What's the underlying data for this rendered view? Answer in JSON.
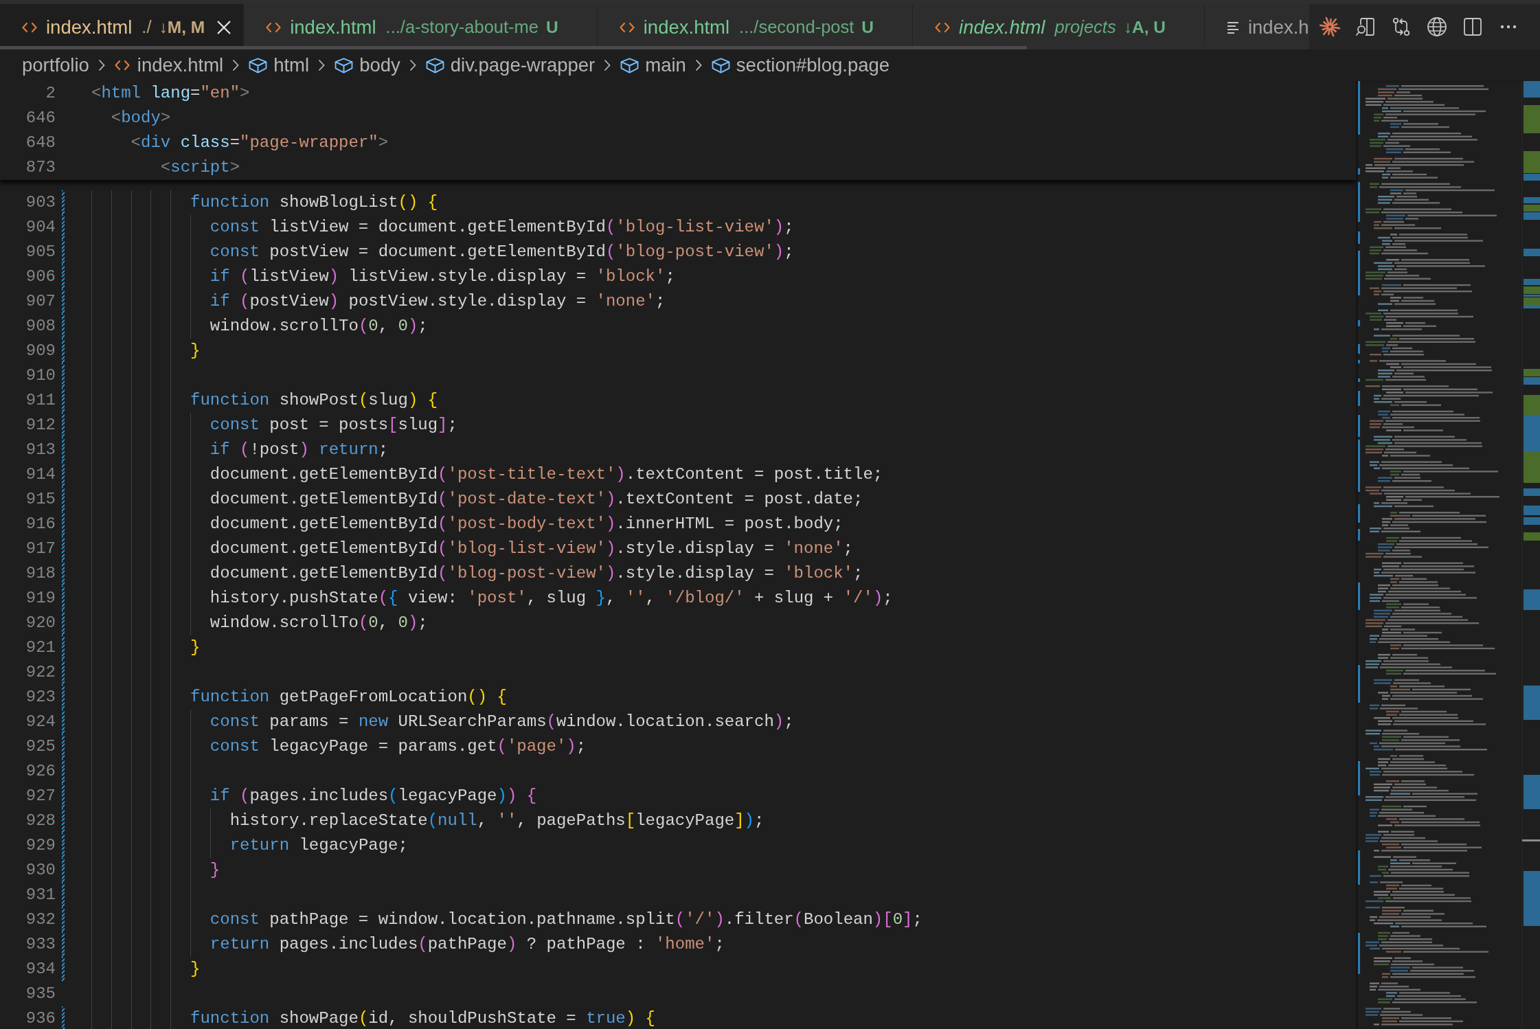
{
  "tabs": [
    {
      "kind": "html_file",
      "label": "index.html",
      "description": "./",
      "badge": "↓M, M",
      "color": "#e2c08d",
      "selected": true,
      "preview": false
    },
    {
      "kind": "html_file",
      "label": "index.html",
      "description": ".../a-story-about-me",
      "badge": "U",
      "color": "#73c991",
      "selected": false,
      "preview": false
    },
    {
      "kind": "html_file",
      "label": "index.html",
      "description": ".../second-post",
      "badge": "U",
      "color": "#73c991",
      "selected": false,
      "preview": false
    },
    {
      "kind": "html_file",
      "label": "index.html",
      "description": "projects",
      "badge": "↓A, U",
      "color": "#73c991",
      "selected": false,
      "preview": true
    },
    {
      "kind": "page_preview",
      "label": "index.h",
      "color": "#a0a0a0",
      "selected": false,
      "preview": false
    }
  ],
  "breadcrumbs": [
    {
      "kind": "folder",
      "label": "portfolio"
    },
    {
      "kind": "file",
      "label": "index.html"
    },
    {
      "kind": "element",
      "label": "html"
    },
    {
      "kind": "element",
      "label": "body"
    },
    {
      "kind": "element",
      "label": "div.page-wrapper"
    },
    {
      "kind": "element",
      "label": "main"
    },
    {
      "kind": "element",
      "label": "section#blog.page"
    }
  ],
  "sticky_scroll": [
    {
      "number": "2",
      "tokens": [
        {
          "text": "<",
          "kind": "tag_punct"
        },
        {
          "text": "html",
          "kind": "tag"
        },
        {
          "text": " lang",
          "kind": "attr"
        },
        {
          "text": "=",
          "kind": "plain"
        },
        {
          "text": "\"en\"",
          "kind": "string"
        },
        {
          "text": ">",
          "kind": "tag_punct"
        }
      ]
    },
    {
      "number": "646",
      "tokens": [
        {
          "text": "  <",
          "kind": "tag_punct"
        },
        {
          "text": "body",
          "kind": "tag"
        },
        {
          "text": ">",
          "kind": "tag_punct"
        }
      ]
    },
    {
      "number": "648",
      "tokens": [
        {
          "text": "    <",
          "kind": "tag_punct"
        },
        {
          "text": "div",
          "kind": "tag"
        },
        {
          "text": " class",
          "kind": "attr"
        },
        {
          "text": "=",
          "kind": "plain"
        },
        {
          "text": "\"page-wrapper\"",
          "kind": "string"
        },
        {
          "text": ">",
          "kind": "tag_punct"
        }
      ]
    },
    {
      "number": "873",
      "tokens": [
        {
          "text": "       <",
          "kind": "tag_punct"
        },
        {
          "text": "script",
          "kind": "tag"
        },
        {
          "text": ">",
          "kind": "tag_punct"
        }
      ]
    }
  ],
  "code_lines": [
    {
      "number": "903",
      "changed": true,
      "tokens": [
        {
          "text": "          function",
          "kind": "keyword"
        },
        {
          "text": " showBlogList",
          "kind": "plain"
        },
        {
          "text": "() {",
          "kind": "bracket1"
        }
      ]
    },
    {
      "number": "904",
      "changed": true,
      "tokens": [
        {
          "text": "            const",
          "kind": "keyword"
        },
        {
          "text": " listView = document.getElementById",
          "kind": "plain"
        },
        {
          "text": "(",
          "kind": "bracket2"
        },
        {
          "text": "'blog-list-view'",
          "kind": "string"
        },
        {
          "text": ")",
          "kind": "bracket2"
        },
        {
          "text": ";",
          "kind": "plain"
        }
      ]
    },
    {
      "number": "905",
      "changed": true,
      "tokens": [
        {
          "text": "            const",
          "kind": "keyword"
        },
        {
          "text": " postView = document.getElementById",
          "kind": "plain"
        },
        {
          "text": "(",
          "kind": "bracket2"
        },
        {
          "text": "'blog-post-view'",
          "kind": "string"
        },
        {
          "text": ")",
          "kind": "bracket2"
        },
        {
          "text": ";",
          "kind": "plain"
        }
      ]
    },
    {
      "number": "906",
      "changed": true,
      "tokens": [
        {
          "text": "            if",
          "kind": "keyword"
        },
        {
          "text": " (",
          "kind": "bracket2"
        },
        {
          "text": "listView",
          "kind": "plain"
        },
        {
          "text": ")",
          "kind": "bracket2"
        },
        {
          "text": " listView.style.display = ",
          "kind": "plain"
        },
        {
          "text": "'block'",
          "kind": "string"
        },
        {
          "text": ";",
          "kind": "plain"
        }
      ]
    },
    {
      "number": "907",
      "changed": true,
      "tokens": [
        {
          "text": "            if",
          "kind": "keyword"
        },
        {
          "text": " (",
          "kind": "bracket2"
        },
        {
          "text": "postView",
          "kind": "plain"
        },
        {
          "text": ")",
          "kind": "bracket2"
        },
        {
          "text": " postView.style.display = ",
          "kind": "plain"
        },
        {
          "text": "'none'",
          "kind": "string"
        },
        {
          "text": ";",
          "kind": "plain"
        }
      ]
    },
    {
      "number": "908",
      "changed": true,
      "tokens": [
        {
          "text": "            window.scrollTo",
          "kind": "plain"
        },
        {
          "text": "(",
          "kind": "bracket2"
        },
        {
          "text": "0",
          "kind": "number"
        },
        {
          "text": ", ",
          "kind": "plain"
        },
        {
          "text": "0",
          "kind": "number"
        },
        {
          "text": ")",
          "kind": "bracket2"
        },
        {
          "text": ";",
          "kind": "plain"
        }
      ]
    },
    {
      "number": "909",
      "changed": true,
      "tokens": [
        {
          "text": "          }",
          "kind": "bracket1"
        }
      ]
    },
    {
      "number": "910",
      "changed": true
    },
    {
      "number": "911",
      "changed": true,
      "tokens": [
        {
          "text": "          function",
          "kind": "keyword"
        },
        {
          "text": " showPost",
          "kind": "plain"
        },
        {
          "text": "(",
          "kind": "bracket1"
        },
        {
          "text": "slug",
          "kind": "plain"
        },
        {
          "text": ") {",
          "kind": "bracket1"
        }
      ]
    },
    {
      "number": "912",
      "changed": true,
      "tokens": [
        {
          "text": "            const",
          "kind": "keyword"
        },
        {
          "text": " post = posts",
          "kind": "plain"
        },
        {
          "text": "[",
          "kind": "bracket2"
        },
        {
          "text": "slug",
          "kind": "plain"
        },
        {
          "text": "]",
          "kind": "bracket2"
        },
        {
          "text": ";",
          "kind": "plain"
        }
      ]
    },
    {
      "number": "913",
      "changed": true,
      "tokens": [
        {
          "text": "            if",
          "kind": "keyword"
        },
        {
          "text": " (",
          "kind": "bracket2"
        },
        {
          "text": "!post",
          "kind": "plain"
        },
        {
          "text": ")",
          "kind": "bracket2"
        },
        {
          "text": " return",
          "kind": "keyword"
        },
        {
          "text": ";",
          "kind": "plain"
        }
      ]
    },
    {
      "number": "914",
      "changed": true,
      "tokens": [
        {
          "text": "            document.getElementById",
          "kind": "plain"
        },
        {
          "text": "(",
          "kind": "bracket2"
        },
        {
          "text": "'post-title-text'",
          "kind": "string"
        },
        {
          "text": ")",
          "kind": "bracket2"
        },
        {
          "text": ".textContent = post.title;",
          "kind": "plain"
        }
      ]
    },
    {
      "number": "915",
      "changed": true,
      "tokens": [
        {
          "text": "            document.getElementById",
          "kind": "plain"
        },
        {
          "text": "(",
          "kind": "bracket2"
        },
        {
          "text": "'post-date-text'",
          "kind": "string"
        },
        {
          "text": ")",
          "kind": "bracket2"
        },
        {
          "text": ".textContent = post.date;",
          "kind": "plain"
        }
      ]
    },
    {
      "number": "916",
      "changed": true,
      "tokens": [
        {
          "text": "            document.getElementById",
          "kind": "plain"
        },
        {
          "text": "(",
          "kind": "bracket2"
        },
        {
          "text": "'post-body-text'",
          "kind": "string"
        },
        {
          "text": ")",
          "kind": "bracket2"
        },
        {
          "text": ".innerHTML = post.body;",
          "kind": "plain"
        }
      ]
    },
    {
      "number": "917",
      "changed": true,
      "tokens": [
        {
          "text": "            document.getElementById",
          "kind": "plain"
        },
        {
          "text": "(",
          "kind": "bracket2"
        },
        {
          "text": "'blog-list-view'",
          "kind": "string"
        },
        {
          "text": ")",
          "kind": "bracket2"
        },
        {
          "text": ".style.display = ",
          "kind": "plain"
        },
        {
          "text": "'none'",
          "kind": "string"
        },
        {
          "text": ";",
          "kind": "plain"
        }
      ]
    },
    {
      "number": "918",
      "changed": true,
      "tokens": [
        {
          "text": "            document.getElementById",
          "kind": "plain"
        },
        {
          "text": "(",
          "kind": "bracket2"
        },
        {
          "text": "'blog-post-view'",
          "kind": "string"
        },
        {
          "text": ")",
          "kind": "bracket2"
        },
        {
          "text": ".style.display = ",
          "kind": "plain"
        },
        {
          "text": "'block'",
          "kind": "string"
        },
        {
          "text": ";",
          "kind": "plain"
        }
      ]
    },
    {
      "number": "919",
      "changed": true,
      "tokens": [
        {
          "text": "            history.pushState",
          "kind": "plain"
        },
        {
          "text": "(",
          "kind": "bracket2"
        },
        {
          "text": "{",
          "kind": "bracket3"
        },
        {
          "text": " view: ",
          "kind": "plain"
        },
        {
          "text": "'post'",
          "kind": "string"
        },
        {
          "text": ", slug ",
          "kind": "plain"
        },
        {
          "text": "}",
          "kind": "bracket3"
        },
        {
          "text": ", ",
          "kind": "plain"
        },
        {
          "text": "''",
          "kind": "string"
        },
        {
          "text": ", ",
          "kind": "plain"
        },
        {
          "text": "'/blog/'",
          "kind": "string"
        },
        {
          "text": " + slug + ",
          "kind": "plain"
        },
        {
          "text": "'/'",
          "kind": "string"
        },
        {
          "text": ")",
          "kind": "bracket2"
        },
        {
          "text": ";",
          "kind": "plain"
        }
      ]
    },
    {
      "number": "920",
      "changed": true,
      "tokens": [
        {
          "text": "            window.scrollTo",
          "kind": "plain"
        },
        {
          "text": "(",
          "kind": "bracket2"
        },
        {
          "text": "0",
          "kind": "number"
        },
        {
          "text": ", ",
          "kind": "plain"
        },
        {
          "text": "0",
          "kind": "number"
        },
        {
          "text": ")",
          "kind": "bracket2"
        },
        {
          "text": ";",
          "kind": "plain"
        }
      ]
    },
    {
      "number": "921",
      "changed": true,
      "tokens": [
        {
          "text": "          }",
          "kind": "bracket1"
        }
      ]
    },
    {
      "number": "922",
      "changed": true
    },
    {
      "number": "923",
      "changed": true,
      "tokens": [
        {
          "text": "          function",
          "kind": "keyword"
        },
        {
          "text": " getPageFromLocation",
          "kind": "plain"
        },
        {
          "text": "() {",
          "kind": "bracket1"
        }
      ]
    },
    {
      "number": "924",
      "changed": true,
      "tokens": [
        {
          "text": "            const",
          "kind": "keyword"
        },
        {
          "text": " params = ",
          "kind": "plain"
        },
        {
          "text": "new",
          "kind": "keyword"
        },
        {
          "text": " URLSearchParams",
          "kind": "plain"
        },
        {
          "text": "(",
          "kind": "bracket2"
        },
        {
          "text": "window.location.search",
          "kind": "plain"
        },
        {
          "text": ")",
          "kind": "bracket2"
        },
        {
          "text": ";",
          "kind": "plain"
        }
      ]
    },
    {
      "number": "925",
      "changed": true,
      "tokens": [
        {
          "text": "            const",
          "kind": "keyword"
        },
        {
          "text": " legacyPage = params.get",
          "kind": "plain"
        },
        {
          "text": "(",
          "kind": "bracket2"
        },
        {
          "text": "'page'",
          "kind": "string"
        },
        {
          "text": ")",
          "kind": "bracket2"
        },
        {
          "text": ";",
          "kind": "plain"
        }
      ]
    },
    {
      "number": "926",
      "changed": true
    },
    {
      "number": "927",
      "changed": true,
      "tokens": [
        {
          "text": "            if",
          "kind": "keyword"
        },
        {
          "text": " (",
          "kind": "bracket2"
        },
        {
          "text": "pages.includes",
          "kind": "plain"
        },
        {
          "text": "(",
          "kind": "bracket3"
        },
        {
          "text": "legacyPage",
          "kind": "plain"
        },
        {
          "text": ")",
          "kind": "bracket3"
        },
        {
          "text": ") {",
          "kind": "bracket2"
        }
      ]
    },
    {
      "number": "928",
      "changed": true,
      "tokens": [
        {
          "text": "              history.replaceState",
          "kind": "plain"
        },
        {
          "text": "(",
          "kind": "bracket3"
        },
        {
          "text": "null",
          "kind": "keyword"
        },
        {
          "text": ", ",
          "kind": "plain"
        },
        {
          "text": "''",
          "kind": "string"
        },
        {
          "text": ", pagePaths",
          "kind": "plain"
        },
        {
          "text": "[",
          "kind": "bracket1"
        },
        {
          "text": "legacyPage",
          "kind": "plain"
        },
        {
          "text": "]",
          "kind": "bracket1"
        },
        {
          "text": ")",
          "kind": "bracket3"
        },
        {
          "text": ";",
          "kind": "plain"
        }
      ]
    },
    {
      "number": "929",
      "changed": true,
      "tokens": [
        {
          "text": "              return",
          "kind": "keyword"
        },
        {
          "text": " legacyPage;",
          "kind": "plain"
        }
      ]
    },
    {
      "number": "930",
      "changed": true,
      "tokens": [
        {
          "text": "            }",
          "kind": "bracket2"
        }
      ]
    },
    {
      "number": "931",
      "changed": true
    },
    {
      "number": "932",
      "changed": true,
      "tokens": [
        {
          "text": "            const",
          "kind": "keyword"
        },
        {
          "text": " pathPage = window.location.pathname.split",
          "kind": "plain"
        },
        {
          "text": "(",
          "kind": "bracket2"
        },
        {
          "text": "'/'",
          "kind": "string"
        },
        {
          "text": ")",
          "kind": "bracket2"
        },
        {
          "text": ".filter",
          "kind": "plain"
        },
        {
          "text": "(",
          "kind": "bracket2"
        },
        {
          "text": "Boolean",
          "kind": "plain"
        },
        {
          "text": ")[",
          "kind": "bracket2"
        },
        {
          "text": "0",
          "kind": "number"
        },
        {
          "text": "]",
          "kind": "bracket2"
        },
        {
          "text": ";",
          "kind": "plain"
        }
      ]
    },
    {
      "number": "933",
      "changed": true,
      "tokens": [
        {
          "text": "            return",
          "kind": "keyword"
        },
        {
          "text": " pages.includes",
          "kind": "plain"
        },
        {
          "text": "(",
          "kind": "bracket2"
        },
        {
          "text": "pathPage",
          "kind": "plain"
        },
        {
          "text": ")",
          "kind": "bracket2"
        },
        {
          "text": " ? pathPage : ",
          "kind": "plain"
        },
        {
          "text": "'home'",
          "kind": "string"
        },
        {
          "text": ";",
          "kind": "plain"
        }
      ]
    },
    {
      "number": "934",
      "changed": true,
      "tokens": [
        {
          "text": "          }",
          "kind": "bracket1"
        }
      ]
    },
    {
      "number": "935",
      "changed": false
    },
    {
      "number": "936",
      "changed": true,
      "tokens": [
        {
          "text": "          function",
          "kind": "keyword"
        },
        {
          "text": " showPage",
          "kind": "plain"
        },
        {
          "text": "(",
          "kind": "bracket1"
        },
        {
          "text": "id, shouldPushState = ",
          "kind": "plain"
        },
        {
          "text": "true",
          "kind": "keyword"
        },
        {
          "text": ") {",
          "kind": "bracket1"
        }
      ]
    }
  ]
}
